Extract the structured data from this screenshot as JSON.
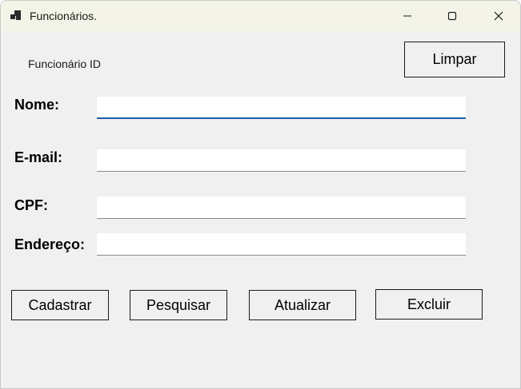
{
  "window": {
    "title": "Funcionários.",
    "icons": {
      "app": "app-icon",
      "minimize": "minimize-icon",
      "maximize": "maximize-icon",
      "close": "close-icon"
    }
  },
  "form": {
    "id_label": "Funcionário ID",
    "fields": {
      "nome": {
        "label": "Nome:",
        "value": ""
      },
      "email": {
        "label": "E-mail:",
        "value": ""
      },
      "cpf": {
        "label": "CPF:",
        "value": ""
      },
      "endereco": {
        "label": "Endereço:",
        "value": ""
      }
    }
  },
  "buttons": {
    "limpar": "Limpar",
    "cadastrar": "Cadastrar",
    "pesquisar": "Pesquisar",
    "atualizar": "Atualizar",
    "excluir": "Excluir"
  },
  "colors": {
    "window_bg": "#f0f0f0",
    "titlebar_bg": "#f3f3e8",
    "focus_accent": "#1f5fa5"
  }
}
